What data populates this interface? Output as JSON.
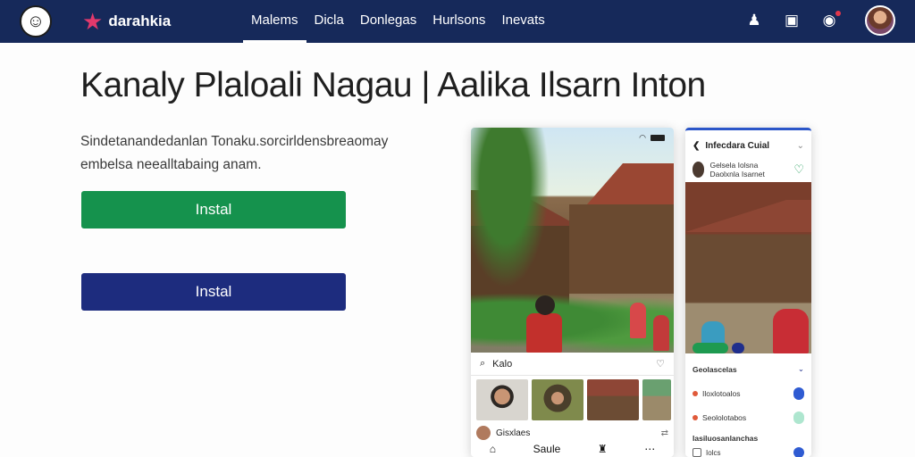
{
  "nav": {
    "brand": "darahkia",
    "links": [
      {
        "label": "Malems",
        "active": true
      },
      {
        "label": "Dicla",
        "active": false
      },
      {
        "label": "Donlegas",
        "active": false
      },
      {
        "label": "Hurlsons",
        "active": false
      },
      {
        "label": "Inevats",
        "active": false
      }
    ],
    "icons": [
      "user-icon",
      "bookmark-icon",
      "chat-icon"
    ]
  },
  "hero": {
    "title": "Kanaly Plaloali Nagau | Aalika Ilsarn Inton",
    "subtitle": "Sindetanandedanlan Tonaku.sorcirldensbreaomay embelsa neealltabaing anam.",
    "primary_button": "Instal",
    "secondary_button": "Instal"
  },
  "phone1": {
    "search_text": "Kalo",
    "row_text": "Gisxlaes",
    "bottom_text": "Saule"
  },
  "phone2": {
    "header": "Infecdara Cuial",
    "user": "Gelsela Iolsna Daolxnla Isarnet",
    "section": "Geolascelas",
    "rows": [
      {
        "label": "Iloxlotoalos"
      },
      {
        "label": "Seololotabos"
      }
    ],
    "bottom_title": "Iasiluosanlanchas",
    "bottom_row": "Iolcs"
  },
  "colors": {
    "nav_bg": "#16295a",
    "primary_button": "#15924d",
    "secondary_button": "#1d2c7e"
  }
}
